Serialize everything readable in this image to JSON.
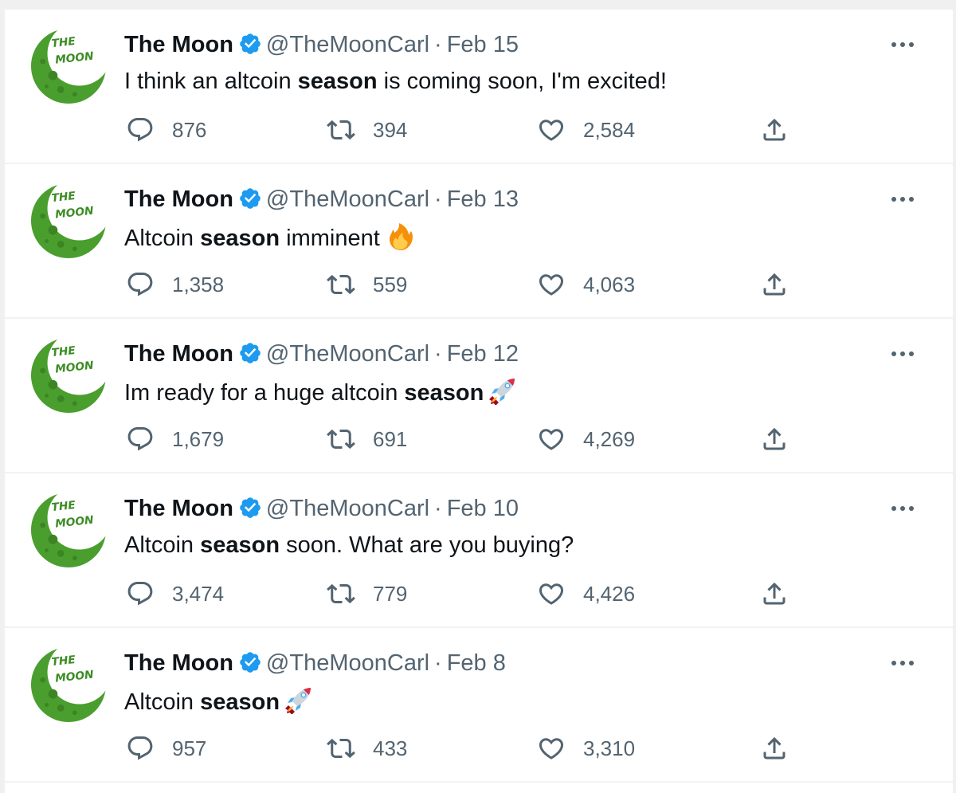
{
  "colors": {
    "verified": "#1d9bf0",
    "avatar_green": "#4a9e2e",
    "text": "#0f1419",
    "muted": "#536471"
  },
  "icons": {
    "reply": "reply-icon",
    "retweet": "retweet-icon",
    "like": "heart-icon",
    "share": "share-icon",
    "more": "more-icon",
    "verified": "verified-badge-icon"
  },
  "avatar_text": [
    "THE",
    "MOON"
  ],
  "tweets": [
    {
      "name": "The Moon",
      "handle": "@TheMoonCarl",
      "date": "Feb 15",
      "text_before": "I think an altcoin ",
      "text_bold": "season",
      "text_after": " is coming soon, I'm excited!",
      "emoji": "",
      "replies": "876",
      "retweets": "394",
      "likes": "2,584"
    },
    {
      "name": "The Moon",
      "handle": "@TheMoonCarl",
      "date": "Feb 13",
      "text_before": "Altcoin ",
      "text_bold": "season",
      "text_after": " imminent",
      "emoji": "fire",
      "replies": "1,358",
      "retweets": "559",
      "likes": "4,063"
    },
    {
      "name": "The Moon",
      "handle": "@TheMoonCarl",
      "date": "Feb 12",
      "text_before": "Im ready for a huge altcoin ",
      "text_bold": "season",
      "text_after": "",
      "emoji": "rocket",
      "replies": "1,679",
      "retweets": "691",
      "likes": "4,269"
    },
    {
      "name": "The Moon",
      "handle": "@TheMoonCarl",
      "date": "Feb 10",
      "text_before": "Altcoin ",
      "text_bold": "season",
      "text_after": " soon. What are you buying?",
      "emoji": "",
      "replies": "3,474",
      "retweets": "779",
      "likes": "4,426"
    },
    {
      "name": "The Moon",
      "handle": "@TheMoonCarl",
      "date": "Feb 8",
      "text_before": "Altcoin ",
      "text_bold": "season",
      "text_after": "",
      "emoji": "rocket",
      "replies": "957",
      "retweets": "433",
      "likes": "3,310"
    }
  ]
}
